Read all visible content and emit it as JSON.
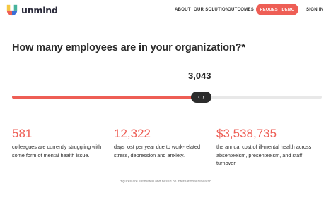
{
  "brand": {
    "name": "unmind"
  },
  "nav": {
    "about": "ABOUT",
    "our_solution": "OUR SOLUTION",
    "outcomes": "OUTCOMES",
    "request_demo": "REQUEST DEMO",
    "sign_in": "SIGN IN"
  },
  "calculator": {
    "question": "How many employees are in your organization?*",
    "value": "3,043",
    "slider_fill_fraction": 0.6,
    "thumb_icons": [
      "chevron-left-icon",
      "chevron-right-icon"
    ]
  },
  "stats": [
    {
      "number": "581",
      "description": "colleagues are currently struggling with some form of mental health issue."
    },
    {
      "number": "12,322",
      "description": "days lost per year due to work-related stress, depression and anxiety."
    },
    {
      "number": "$3,538,735",
      "description": "the annual cost of ill-mental health across absenteeism, presenteeism, and staff turnover."
    }
  ],
  "footnote": "*figures are estimated and based on international research",
  "colors": {
    "accent": "#ee5e55",
    "dark": "#2c2c2c",
    "track": "#e8e8e8",
    "logo_yellow": "#f5c842",
    "logo_green": "#47b39c",
    "logo_red": "#ee5e55",
    "logo_blue": "#3b6fd6"
  }
}
